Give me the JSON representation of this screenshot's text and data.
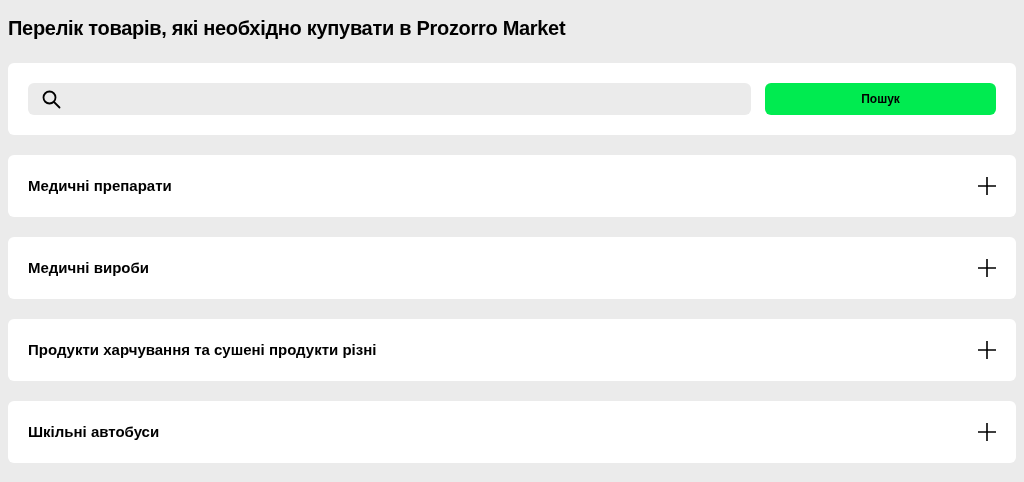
{
  "title": "Перелік товарів, які необхідно купувати в Prozorro Market",
  "search": {
    "button": "Пошук"
  },
  "categories": [
    {
      "label": "Медичні препарати",
      "expanded": false
    },
    {
      "label": "Медичні вироби",
      "expanded": false
    },
    {
      "label": "Продукти харчування та сушені продукти різні",
      "expanded": false
    },
    {
      "label": "Шкільні автобуси",
      "expanded": false
    }
  ]
}
